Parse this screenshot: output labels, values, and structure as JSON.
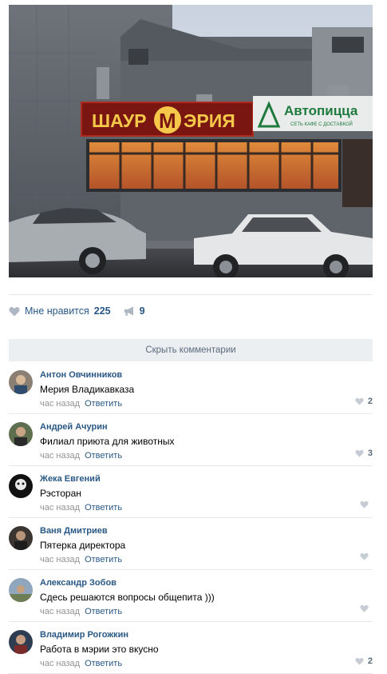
{
  "post": {
    "photo": {
      "sign_main": "ШАУР",
      "sign_logo": "М",
      "sign_rest": "ЭРИЯ",
      "sign2_title": "Автопицца",
      "sign2_sub": "СЕТЬ КАФЕ С ДОСТАВКОЙ"
    },
    "likes_label": "Мне нравится",
    "likes_count": "225",
    "shares_count": "9"
  },
  "hide_comments_label": "Скрыть комментарии",
  "comments": [
    {
      "author": "Антон Овчинников",
      "text": "Мерия Владикавказа",
      "time": "час назад",
      "reply": "Ответить",
      "likes": "2"
    },
    {
      "author": "Андрей Ачурин",
      "text": "Филиал приюта для животных",
      "time": "час назад",
      "reply": "Ответить",
      "likes": "3"
    },
    {
      "author": "Жека Евгений",
      "text": "Рэсторан",
      "time": "час назад",
      "reply": "Ответить",
      "likes": ""
    },
    {
      "author": "Ваня Дмитриев",
      "text": "Пятерка директора",
      "time": "час назад",
      "reply": "Ответить",
      "likes": ""
    },
    {
      "author": "Александр Зобов",
      "text": "Сдесь решаются вопросы общепита )))",
      "time": "час назад",
      "reply": "Ответить",
      "likes": ""
    },
    {
      "author": "Владимир Рогожкин",
      "text": "Работа в мэрии это вкусно",
      "time": "час назад",
      "reply": "Ответить",
      "likes": "2"
    }
  ],
  "colors": {
    "link": "#2a5885",
    "meta": "#939393",
    "sign_bg": "#7a1612",
    "sign_text": "#f5c84a",
    "sign2_text": "#1f7a3d"
  }
}
